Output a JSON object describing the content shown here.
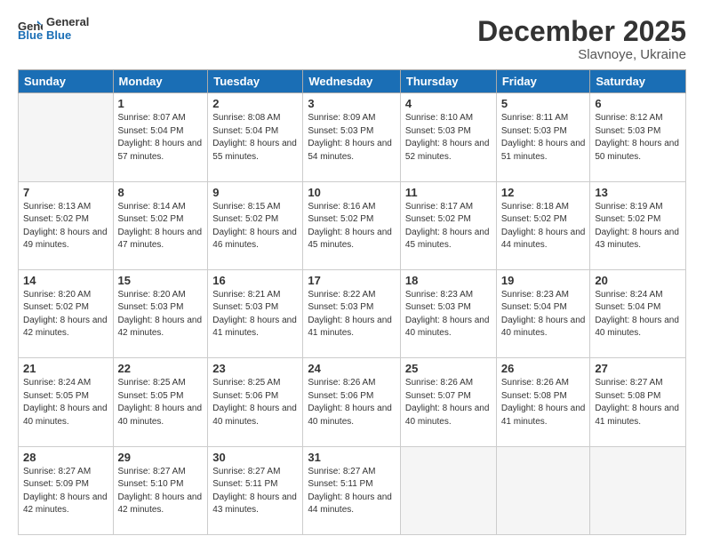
{
  "header": {
    "logo_line1": "General",
    "logo_line2": "Blue",
    "month": "December 2025",
    "location": "Slavnoye, Ukraine"
  },
  "weekdays": [
    "Sunday",
    "Monday",
    "Tuesday",
    "Wednesday",
    "Thursday",
    "Friday",
    "Saturday"
  ],
  "weeks": [
    [
      {
        "day": "",
        "empty": true
      },
      {
        "day": "1",
        "sunrise": "8:07 AM",
        "sunset": "5:04 PM",
        "daylight": "8 hours and 57 minutes."
      },
      {
        "day": "2",
        "sunrise": "8:08 AM",
        "sunset": "5:04 PM",
        "daylight": "8 hours and 55 minutes."
      },
      {
        "day": "3",
        "sunrise": "8:09 AM",
        "sunset": "5:03 PM",
        "daylight": "8 hours and 54 minutes."
      },
      {
        "day": "4",
        "sunrise": "8:10 AM",
        "sunset": "5:03 PM",
        "daylight": "8 hours and 52 minutes."
      },
      {
        "day": "5",
        "sunrise": "8:11 AM",
        "sunset": "5:03 PM",
        "daylight": "8 hours and 51 minutes."
      },
      {
        "day": "6",
        "sunrise": "8:12 AM",
        "sunset": "5:03 PM",
        "daylight": "8 hours and 50 minutes."
      }
    ],
    [
      {
        "day": "7",
        "sunrise": "8:13 AM",
        "sunset": "5:02 PM",
        "daylight": "8 hours and 49 minutes."
      },
      {
        "day": "8",
        "sunrise": "8:14 AM",
        "sunset": "5:02 PM",
        "daylight": "8 hours and 47 minutes."
      },
      {
        "day": "9",
        "sunrise": "8:15 AM",
        "sunset": "5:02 PM",
        "daylight": "8 hours and 46 minutes."
      },
      {
        "day": "10",
        "sunrise": "8:16 AM",
        "sunset": "5:02 PM",
        "daylight": "8 hours and 45 minutes."
      },
      {
        "day": "11",
        "sunrise": "8:17 AM",
        "sunset": "5:02 PM",
        "daylight": "8 hours and 45 minutes."
      },
      {
        "day": "12",
        "sunrise": "8:18 AM",
        "sunset": "5:02 PM",
        "daylight": "8 hours and 44 minutes."
      },
      {
        "day": "13",
        "sunrise": "8:19 AM",
        "sunset": "5:02 PM",
        "daylight": "8 hours and 43 minutes."
      }
    ],
    [
      {
        "day": "14",
        "sunrise": "8:20 AM",
        "sunset": "5:02 PM",
        "daylight": "8 hours and 42 minutes."
      },
      {
        "day": "15",
        "sunrise": "8:20 AM",
        "sunset": "5:03 PM",
        "daylight": "8 hours and 42 minutes."
      },
      {
        "day": "16",
        "sunrise": "8:21 AM",
        "sunset": "5:03 PM",
        "daylight": "8 hours and 41 minutes."
      },
      {
        "day": "17",
        "sunrise": "8:22 AM",
        "sunset": "5:03 PM",
        "daylight": "8 hours and 41 minutes."
      },
      {
        "day": "18",
        "sunrise": "8:23 AM",
        "sunset": "5:03 PM",
        "daylight": "8 hours and 40 minutes."
      },
      {
        "day": "19",
        "sunrise": "8:23 AM",
        "sunset": "5:04 PM",
        "daylight": "8 hours and 40 minutes."
      },
      {
        "day": "20",
        "sunrise": "8:24 AM",
        "sunset": "5:04 PM",
        "daylight": "8 hours and 40 minutes."
      }
    ],
    [
      {
        "day": "21",
        "sunrise": "8:24 AM",
        "sunset": "5:05 PM",
        "daylight": "8 hours and 40 minutes."
      },
      {
        "day": "22",
        "sunrise": "8:25 AM",
        "sunset": "5:05 PM",
        "daylight": "8 hours and 40 minutes."
      },
      {
        "day": "23",
        "sunrise": "8:25 AM",
        "sunset": "5:06 PM",
        "daylight": "8 hours and 40 minutes."
      },
      {
        "day": "24",
        "sunrise": "8:26 AM",
        "sunset": "5:06 PM",
        "daylight": "8 hours and 40 minutes."
      },
      {
        "day": "25",
        "sunrise": "8:26 AM",
        "sunset": "5:07 PM",
        "daylight": "8 hours and 40 minutes."
      },
      {
        "day": "26",
        "sunrise": "8:26 AM",
        "sunset": "5:08 PM",
        "daylight": "8 hours and 41 minutes."
      },
      {
        "day": "27",
        "sunrise": "8:27 AM",
        "sunset": "5:08 PM",
        "daylight": "8 hours and 41 minutes."
      }
    ],
    [
      {
        "day": "28",
        "sunrise": "8:27 AM",
        "sunset": "5:09 PM",
        "daylight": "8 hours and 42 minutes."
      },
      {
        "day": "29",
        "sunrise": "8:27 AM",
        "sunset": "5:10 PM",
        "daylight": "8 hours and 42 minutes."
      },
      {
        "day": "30",
        "sunrise": "8:27 AM",
        "sunset": "5:11 PM",
        "daylight": "8 hours and 43 minutes."
      },
      {
        "day": "31",
        "sunrise": "8:27 AM",
        "sunset": "5:11 PM",
        "daylight": "8 hours and 44 minutes."
      },
      {
        "day": "",
        "empty": true
      },
      {
        "day": "",
        "empty": true
      },
      {
        "day": "",
        "empty": true
      }
    ]
  ]
}
